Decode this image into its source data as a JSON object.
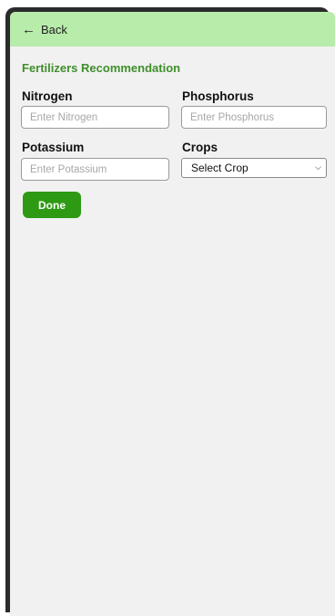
{
  "header": {
    "back_label": "Back",
    "back_icon": "arrow-left-icon"
  },
  "page": {
    "title": "Fertilizers Recommendation"
  },
  "form": {
    "nitrogen": {
      "label": "Nitrogen",
      "placeholder": "Enter Nitrogen",
      "value": ""
    },
    "phosphorus": {
      "label": "Phosphorus",
      "placeholder": "Enter Phosphorus",
      "value": ""
    },
    "potassium": {
      "label": "Potassium",
      "placeholder": "Enter Potassium",
      "value": ""
    },
    "crops": {
      "label": "Crops",
      "selected": "Select Crop",
      "icon": "chevron-down-icon"
    },
    "submit_label": "Done"
  },
  "colors": {
    "header_bg": "#b7ecaa",
    "title": "#3f8f2a",
    "button_bg": "#2e9a14",
    "page_bg": "#f1f1f1",
    "device_frame": "#2b2b2b"
  }
}
